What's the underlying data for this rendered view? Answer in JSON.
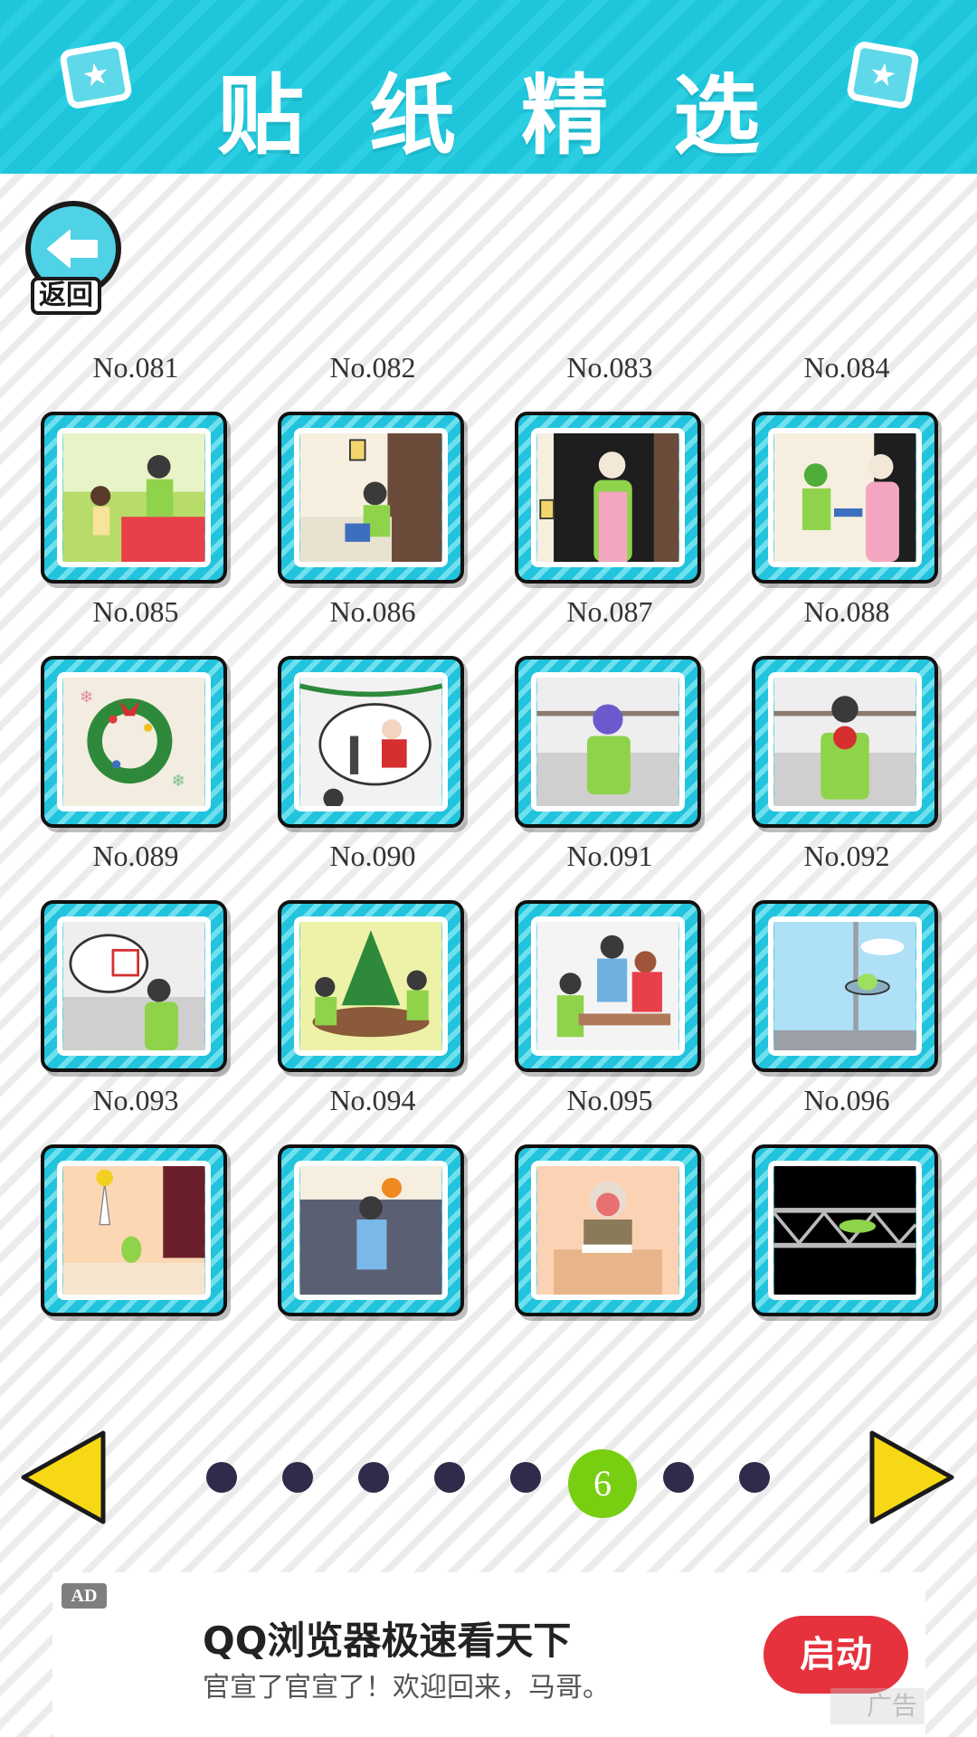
{
  "header": {
    "title": "贴纸精选",
    "left_icon": "star-card-icon",
    "right_icon": "star-card-icon"
  },
  "back_button": {
    "label": "返回",
    "icon": "arrow-left-icon"
  },
  "stickers": [
    {
      "label": "No.081",
      "scene": "boy-girl-park"
    },
    {
      "label": "No.082",
      "scene": "boy-door"
    },
    {
      "label": "No.083",
      "scene": "woman-door"
    },
    {
      "label": "No.084",
      "scene": "delivery-woman"
    },
    {
      "label": "No.085",
      "scene": "wreath"
    },
    {
      "label": "No.086",
      "scene": "santa-dream"
    },
    {
      "label": "No.087",
      "scene": "boy-stressed"
    },
    {
      "label": "No.088",
      "scene": "boy-flowers"
    },
    {
      "label": "No.089",
      "scene": "gift-dream"
    },
    {
      "label": "No.090",
      "scene": "christmas-party"
    },
    {
      "label": "No.091",
      "scene": "classroom"
    },
    {
      "label": "No.092",
      "scene": "ufo-window"
    },
    {
      "label": "No.093",
      "scene": "vase-room"
    },
    {
      "label": "No.094",
      "scene": "basketball-crowd"
    },
    {
      "label": "No.095",
      "scene": "old-professor"
    },
    {
      "label": "No.096",
      "scene": "dark-bridge"
    }
  ],
  "pagination": {
    "current_page": "6",
    "total_pages": 8,
    "prev_icon": "triangle-left-icon",
    "next_icon": "triangle-right-icon"
  },
  "ad": {
    "badge": "AD",
    "title": "QQ浏览器极速看天下",
    "subtitle": "官宣了官宣了！欢迎回来，马哥。",
    "button": "启动",
    "mark": "广告"
  }
}
